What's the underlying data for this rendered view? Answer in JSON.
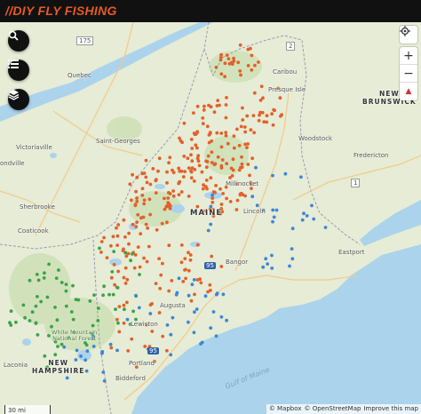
{
  "brand": {
    "title": "//DIY FLY FISHING",
    "color": "#e85a24"
  },
  "map_controls": {
    "search_icon": "search-icon",
    "list_icon": "list-icon",
    "layers_icon": "layers-icon",
    "geolocate_icon": "crosshair-icon",
    "zoom_in": "+",
    "zoom_out": "−",
    "compass": "▲"
  },
  "labels": {
    "quebec": "Quebec",
    "victoriaville": "Victoriaville",
    "ondville": "ondville",
    "saint_georges": "Saint-Georges",
    "sherbrooke": "Sherbrooke",
    "coaticook": "Coaticook",
    "caribou": "Caribou",
    "presque_isle": "Presque Isle",
    "new_brunswick": "NEW\nBRUNSWICK",
    "woodstock": "Woodstock",
    "fredericton": "Fredericton",
    "millinocket": "Millinocket",
    "maine": "MAINE",
    "lincoln": "Lincoln",
    "eastport": "Eastport",
    "bangor": "Bangor",
    "augusta": "Augusta",
    "lewiston": "Lewiston",
    "white_mountain": "White Mountain\nNational Forest",
    "new_hampshire": "NEW\nHAMPSHIRE",
    "portland": "Portland",
    "biddeford": "Biddeford",
    "laconia": "Laconia",
    "gulf_of_maine": "Gulf of Maine",
    "route_175": "175",
    "route_2": "2",
    "route_95": "95",
    "route_1": "1",
    "route_95b": "95"
  },
  "scale": {
    "label": "30 mi"
  },
  "logo": {
    "text": "mapbox"
  },
  "attribution": {
    "mapbox": "© Mapbox",
    "osm": "© OpenStreetMap",
    "improve": "Improve this map"
  },
  "colors": {
    "water": "#abd3ec",
    "land": "#e6ecd5",
    "forest": "#c9e0b2",
    "orange_spot": "#e3602a",
    "blue_spot": "#3d86d6",
    "green_spot": "#3aa34a"
  }
}
